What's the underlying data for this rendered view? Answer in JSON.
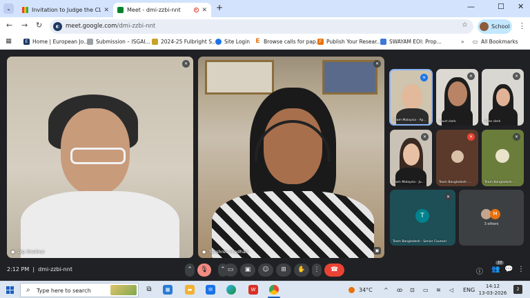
{
  "browser": {
    "tabs": [
      {
        "title": "Invitation to Judge the CLEA Int",
        "active": false
      },
      {
        "title": "Meet - dmi-zzbi-nnt",
        "active": true
      }
    ],
    "url_host": "meet.google.com",
    "url_path": "/dmi-zzbi-nnt",
    "profile_label": "School",
    "bookmarks": [
      "Home | European Jo...",
      "Submission – ISGAI...",
      "2024-25 Fulbright S...",
      "Site Login",
      "Browse calls for pap...",
      "Publish Your Resear...",
      "SWAYAM EOI: Prop..."
    ],
    "all_bookmarks_label": "All Bookmarks"
  },
  "meet": {
    "main_tiles": [
      {
        "name": "Dip Shekhar"
      },
      {
        "name": "Tulishree Pradhan"
      }
    ],
    "side_tiles": [
      {
        "name": "Team Malaysia - Ap..."
      },
      {
        "name": "Court clerk"
      },
      {
        "name": "Time clerk"
      },
      {
        "name": "Team Malaysia - Ju..."
      },
      {
        "name": "Team Bangladesh -..."
      },
      {
        "name": "Team Bangladesh -..."
      },
      {
        "name": "Team Bangladesh - Senior Counsel",
        "avatar_letter": "T"
      },
      {
        "name": "3 others",
        "avatar_letter": "M"
      }
    ],
    "time": "2:12 PM",
    "meeting_code": "dmi-zzbi-nnt",
    "participant_count": "10"
  },
  "taskbar": {
    "search_placeholder": "Type here to search",
    "temperature": "34°C",
    "language": "ENG",
    "clock_time": "14:12",
    "clock_date": "13-03-2026",
    "notification_count": "2"
  },
  "colors": {
    "meet_bg": "#202124",
    "end_call": "#ea4335",
    "mic_muted": "#f28b82",
    "tab_strip": "#d3e3fd"
  }
}
